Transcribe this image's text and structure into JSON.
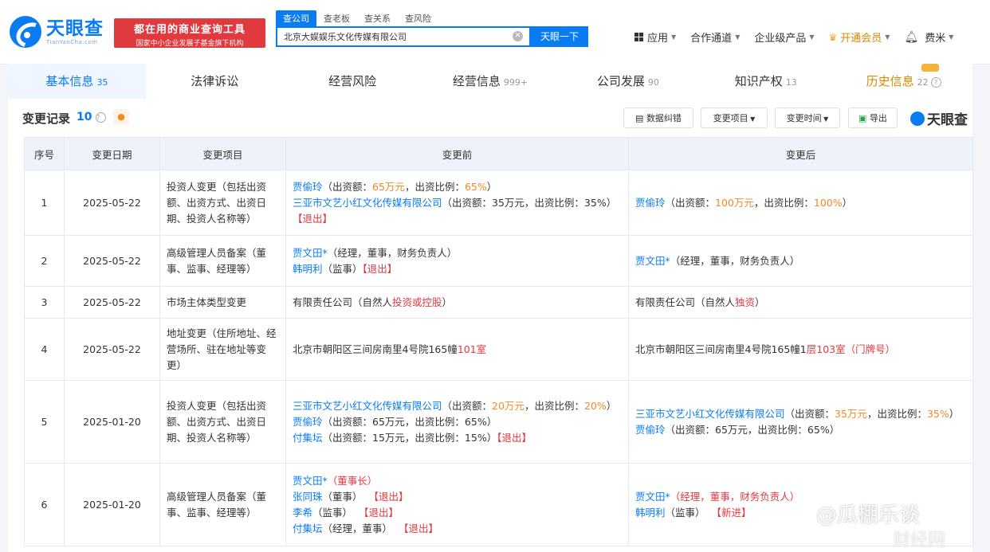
{
  "header": {
    "logo_cn": "天眼查",
    "logo_en": "TianYanCha.com",
    "promo_line1": "都在用的商业查询工具",
    "promo_line2": "国家中小企业发展子基金旗下机构",
    "search_tabs": [
      "查公司",
      "查老板",
      "查关系",
      "查风险"
    ],
    "search_value": "北京大娱娱乐文化传媒有限公司",
    "search_button": "天眼一下",
    "nav": [
      "应用",
      "合作通道",
      "企业级产品",
      "开通会员"
    ],
    "user": "费米"
  },
  "tabs": [
    {
      "label": "基本信息",
      "count": "35"
    },
    {
      "label": "法律诉讼",
      "count": ""
    },
    {
      "label": "经营风险",
      "count": ""
    },
    {
      "label": "经营信息",
      "count": "999+"
    },
    {
      "label": "公司发展",
      "count": "90"
    },
    {
      "label": "知识产权",
      "count": "13"
    },
    {
      "label": "历史信息",
      "count": "22"
    }
  ],
  "section": {
    "title": "变更记录",
    "count": "10",
    "buttons": {
      "data_report": "数据纠错",
      "change_item": "变更项目",
      "change_time": "变更时间",
      "export": "导出"
    },
    "watermark": "天眼查"
  },
  "table": {
    "headers": [
      "序号",
      "变更日期",
      "变更项目",
      "变更前",
      "变更后"
    ]
  },
  "rows": {
    "r1": {
      "no": "1",
      "date": "2025-05-22",
      "item": "投资人变更（包括出资额、出资方式、出资日期、投资人名称等）",
      "b_name1": "贾偷玲",
      "b_t1": "（出资额：",
      "b_v1a": "65万元",
      "b_t1b": "，出资比例：",
      "b_v1b": "65%",
      "b_t1c": "）",
      "b_name2": "三亚市文艺小红文化传媒有限公司",
      "b_t2": "（出资额：35万元，出资比例：35%）",
      "b_exit": "【退出】",
      "a_name": "贾偷玲",
      "a_t1": "（出资额：",
      "a_v1": "100万元",
      "a_t2": "，出资比例：",
      "a_v2": "100%",
      "a_t3": "）"
    },
    "r2": {
      "no": "2",
      "date": "2025-05-22",
      "item": "高级管理人员备案（董事、监事、经理等）",
      "b_name1": "贾文田*",
      "b_t1": "（经理，董事，财务负责人）",
      "b_name2": "韩明利",
      "b_t2": "（监事）",
      "b_exit": "【退出】",
      "a_name": "贾文田*",
      "a_t1": "（经理，董事，财务负责人）"
    },
    "r3": {
      "no": "3",
      "date": "2025-05-22",
      "item": "市场主体类型变更",
      "b_t1": "有限责任公司（自然人",
      "b_hl": "投资或控股",
      "b_t2": "）",
      "a_t1": "有限责任公司（自然人",
      "a_hl": "独资",
      "a_t2": "）"
    },
    "r4": {
      "no": "4",
      "date": "2025-05-22",
      "item": "地址变更（住所地址、经营场所、驻在地址等变更）",
      "b_t1": "北京市朝阳区三间房南里4号院165幢",
      "b_hl": "101室",
      "a_t1": "北京市朝阳区三间房南里4号院165幢1",
      "a_hl": "层103室（门牌号）"
    },
    "r5": {
      "no": "5",
      "date": "2025-01-20",
      "item": "投资人变更（包括出资额、出资方式、出资日期、投资人名称等）",
      "b_name1": "三亚市文艺小红文化传媒有限公司",
      "b_t1": "（出资额：",
      "b_v1a": "20万元",
      "b_t1b": "，出资比例：",
      "b_v1b": "20%",
      "b_t1c": "）",
      "b_name2": "贾偷玲",
      "b_t2": "（出资额：65万元，出资比例：65%）",
      "b_name3": "付集坛",
      "b_t3": "（出资额：15万元，出资比例：15%）",
      "b_exit": "【退出】",
      "a_name1": "三亚市文艺小红文化传媒有限公司",
      "a_t1": "（出资额：",
      "a_v1": "35万元",
      "a_t1b": "，出资比例：",
      "a_v1b": "35%",
      "a_t1c": "）",
      "a_name2": "贾偷玲",
      "a_t2": "（出资额：65万元，出资比例：65%）"
    },
    "r6": {
      "no": "6",
      "date": "2025-01-20",
      "item": "高级管理人员备案（董事、监事、经理等）",
      "b_name1": "贾文田*",
      "b_hl1": "（董事长）",
      "b_name2": "张同珠",
      "b_t2": "（董事）",
      "b_exit2": "【退出】",
      "b_name3": "李希",
      "b_t3": "（监事）",
      "b_exit3": "【退出】",
      "b_name4": "付集坛",
      "b_t4": "（经理，董事）",
      "b_exit4": "【退出】",
      "a_name1": "贾文田*",
      "a_hl1": "（经理，董事，财务负责人）",
      "a_name2": "韩明利",
      "a_t2": "（监事）",
      "a_new": "【新进】"
    }
  },
  "watermark_text": "@瓜棚乐谈",
  "watermark_text2": "财经网"
}
